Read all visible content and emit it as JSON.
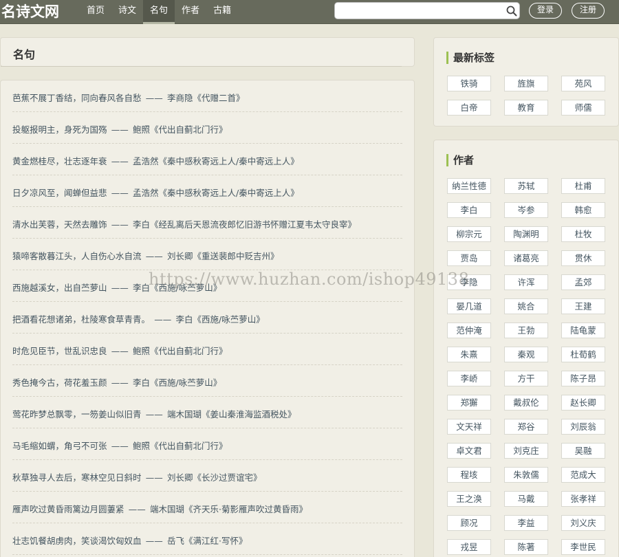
{
  "header": {
    "logo": "名诗文网",
    "nav": [
      {
        "label": "首页",
        "active": false
      },
      {
        "label": "诗文",
        "active": false
      },
      {
        "label": "名句",
        "active": true
      },
      {
        "label": "作者",
        "active": false
      },
      {
        "label": "古籍",
        "active": false
      }
    ],
    "search": {
      "value": "",
      "placeholder": ""
    },
    "login_label": "登录",
    "register_label": "注册"
  },
  "main": {
    "title": "名句",
    "quotes": [
      {
        "text": "芭蕉不展丁香结，同向春风各自愁",
        "sep": "——",
        "author": "李商隐",
        "work": "《代赠二首》"
      },
      {
        "text": "投躯报明主，身死为国殇",
        "sep": "——",
        "author": "鲍照",
        "work": "《代出自蓟北门行》"
      },
      {
        "text": "黄金燃桂尽，壮志逐年衰",
        "sep": "——",
        "author": "孟浩然",
        "work": "《秦中感秋寄远上人/秦中寄远上人》"
      },
      {
        "text": "日夕凉风至，闻蝉但益悲",
        "sep": "——",
        "author": "孟浩然",
        "work": "《秦中感秋寄远上人/秦中寄远上人》"
      },
      {
        "text": "清水出芙蓉，天然去雕饰",
        "sep": "——",
        "author": "李白",
        "work": "《经乱离后天恩流夜郎忆旧游书怀赠江夏韦太守良宰》"
      },
      {
        "text": "猿啼客散暮江头，人自伤心水自流",
        "sep": "——",
        "author": "刘长卿",
        "work": "《重送裴郎中贬吉州》"
      },
      {
        "text": "西施越溪女，出自苎萝山",
        "sep": "——",
        "author": "李白",
        "work": "《西施/咏苎萝山》"
      },
      {
        "text": "把酒看花想诸弟，杜陵寒食草青青。",
        "sep": "——",
        "author": "李白",
        "work": "《西施/咏苎萝山》"
      },
      {
        "text": "时危见臣节，世乱识忠良",
        "sep": "——",
        "author": "鲍照",
        "work": "《代出自蓟北门行》"
      },
      {
        "text": "秀色掩今古，荷花羞玉颜",
        "sep": "——",
        "author": "李白",
        "work": "《西施/咏苎萝山》"
      },
      {
        "text": "莺花昨梦总飘零，一笏姜山似旧青",
        "sep": "——",
        "author": "端木国瑚",
        "work": "《姜山秦淮海监酒税处》"
      },
      {
        "text": "马毛缩如蝟，角弓不可张",
        "sep": "——",
        "author": "鲍照",
        "work": "《代出自蓟北门行》"
      },
      {
        "text": "秋草独寻人去后，寒林空见日斜时",
        "sep": "——",
        "author": "刘长卿",
        "work": "《长沙过贾谊宅》"
      },
      {
        "text": "雁声吹过黄昏雨篱边月圆萋紧",
        "sep": "——",
        "author": "端木国瑚",
        "work": "《齐天乐·菊影雁声吹过黄昏雨》"
      },
      {
        "text": "壮志饥餐胡虏肉，笑谈渴饮匈奴血",
        "sep": "——",
        "author": "岳飞",
        "work": "《满江红·写怀》"
      }
    ]
  },
  "sidebar": {
    "tags_title": "最新标签",
    "tags": [
      "铁骑",
      "旌旗",
      "苑风",
      "白帝",
      "教育",
      "师儒"
    ],
    "authors_title": "作者",
    "authors": [
      "纳兰性德",
      "苏轼",
      "杜甫",
      "李白",
      "岑参",
      "韩愈",
      "柳宗元",
      "陶渊明",
      "杜牧",
      "贾岛",
      "诸葛亮",
      "贯休",
      "李隐",
      "许浑",
      "孟郊",
      "晏几道",
      "姚合",
      "王建",
      "范仲淹",
      "王勃",
      "陆龟蒙",
      "朱熹",
      "秦观",
      "杜荀鹤",
      "李峤",
      "方干",
      "陈子昂",
      "郑獬",
      "戴叔伦",
      "赵长卿",
      "文天祥",
      "郑谷",
      "刘辰翁",
      "卓文君",
      "刘克庄",
      "吴融",
      "程垓",
      "朱敦儒",
      "范成大",
      "王之涣",
      "马戴",
      "张孝祥",
      "顾况",
      "李益",
      "刘义庆",
      "戎昱",
      "陈著",
      "李世民"
    ]
  },
  "watermark": "https://www.huzhan.com/ishop49138"
}
